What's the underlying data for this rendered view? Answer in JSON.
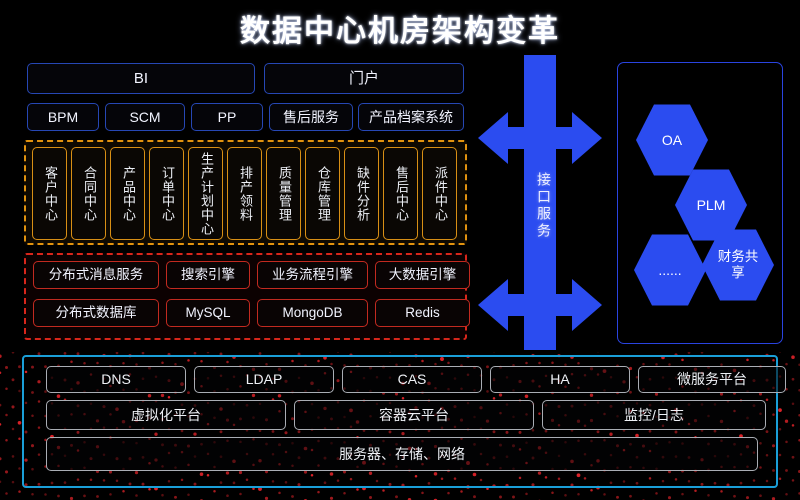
{
  "title": "数据中心机房架构变革",
  "colors": {
    "background": "#000000",
    "accent_blue": "#2b4cf0",
    "box_blue_border": "#2647b4",
    "orange": "#e2930f",
    "red": "#d8261b",
    "cyan": "#1a9fd8",
    "gray_border": "#a9adb4"
  },
  "app_layer": {
    "top_row": [
      {
        "label": "BI"
      },
      {
        "label": "门户"
      }
    ],
    "second_row": [
      {
        "label": "BPM"
      },
      {
        "label": "SCM"
      },
      {
        "label": "PP"
      },
      {
        "label": "售后服务"
      },
      {
        "label": "产品档案系统"
      }
    ]
  },
  "center_modules": {
    "items": [
      {
        "label": "客户中心"
      },
      {
        "label": "合同中心"
      },
      {
        "label": "产品中心"
      },
      {
        "label": "订单中心"
      },
      {
        "label": "生产计划中心"
      },
      {
        "label": "排产领料"
      },
      {
        "label": "质量管理"
      },
      {
        "label": "仓库管理"
      },
      {
        "label": "缺件分析"
      },
      {
        "label": "售后中心"
      },
      {
        "label": "派件中心"
      }
    ]
  },
  "middleware_layer": {
    "row1": [
      {
        "label": "分布式消息服务"
      },
      {
        "label": "搜索引擎"
      },
      {
        "label": "业务流程引擎"
      },
      {
        "label": "大数据引擎"
      }
    ],
    "row2": [
      {
        "label": "分布式数据库"
      },
      {
        "label": "MySQL"
      },
      {
        "label": "MongoDB"
      },
      {
        "label": "Redis"
      }
    ]
  },
  "interface_service": {
    "label": "接口服务"
  },
  "external_systems": {
    "hexagons": [
      {
        "label": "OA"
      },
      {
        "label": "PLM"
      },
      {
        "label": "......"
      },
      {
        "label": "财务共享"
      }
    ]
  },
  "infrastructure": {
    "row1": [
      {
        "label": "DNS"
      },
      {
        "label": "LDAP"
      },
      {
        "label": "CAS"
      },
      {
        "label": "HA"
      },
      {
        "label": "微服务平台"
      }
    ],
    "row2": [
      {
        "label": "虚拟化平台"
      },
      {
        "label": "容器云平台"
      },
      {
        "label": "监控/日志"
      }
    ],
    "row3": [
      {
        "label": "服务器、存储、网络"
      }
    ]
  }
}
